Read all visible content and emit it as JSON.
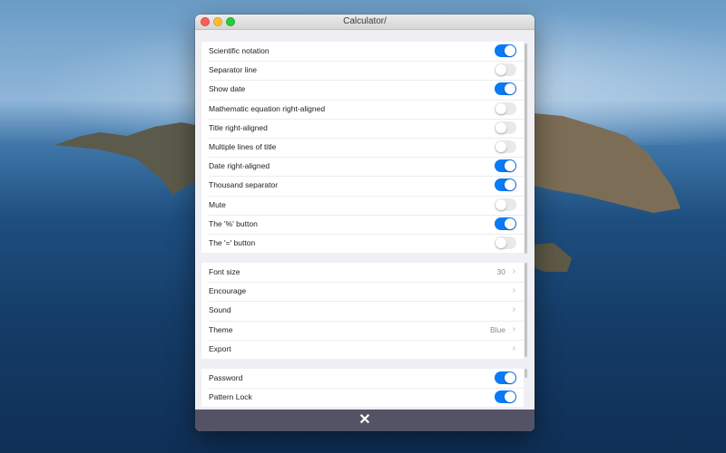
{
  "window": {
    "title": "Calculator/"
  },
  "toggles": [
    {
      "label": "Scientific notation",
      "on": true
    },
    {
      "label": "Separator line",
      "on": false
    },
    {
      "label": "Show date",
      "on": true
    },
    {
      "label": "Mathematic equation right-aligned",
      "on": false
    },
    {
      "label": "Title right-aligned",
      "on": false
    },
    {
      "label": "Multiple lines of title",
      "on": false
    },
    {
      "label": "Date right-aligned",
      "on": true
    },
    {
      "label": "Thousand separator",
      "on": true
    },
    {
      "label": "Mute",
      "on": false
    },
    {
      "label": "The '%' button",
      "on": true
    },
    {
      "label": "The '=' button",
      "on": false
    }
  ],
  "settings": [
    {
      "label": "Font size",
      "value": "30"
    },
    {
      "label": "Encourage",
      "value": ""
    },
    {
      "label": "Sound",
      "value": ""
    },
    {
      "label": "Theme",
      "value": "Blue"
    },
    {
      "label": "Export",
      "value": ""
    }
  ],
  "security": [
    {
      "label": "Password",
      "on": true
    },
    {
      "label": "Pattern Lock",
      "on": true
    }
  ],
  "bottom": {
    "close_symbol": "✕"
  },
  "colors": {
    "accent": "#0a7af5",
    "bottom_bar": "#545366"
  }
}
